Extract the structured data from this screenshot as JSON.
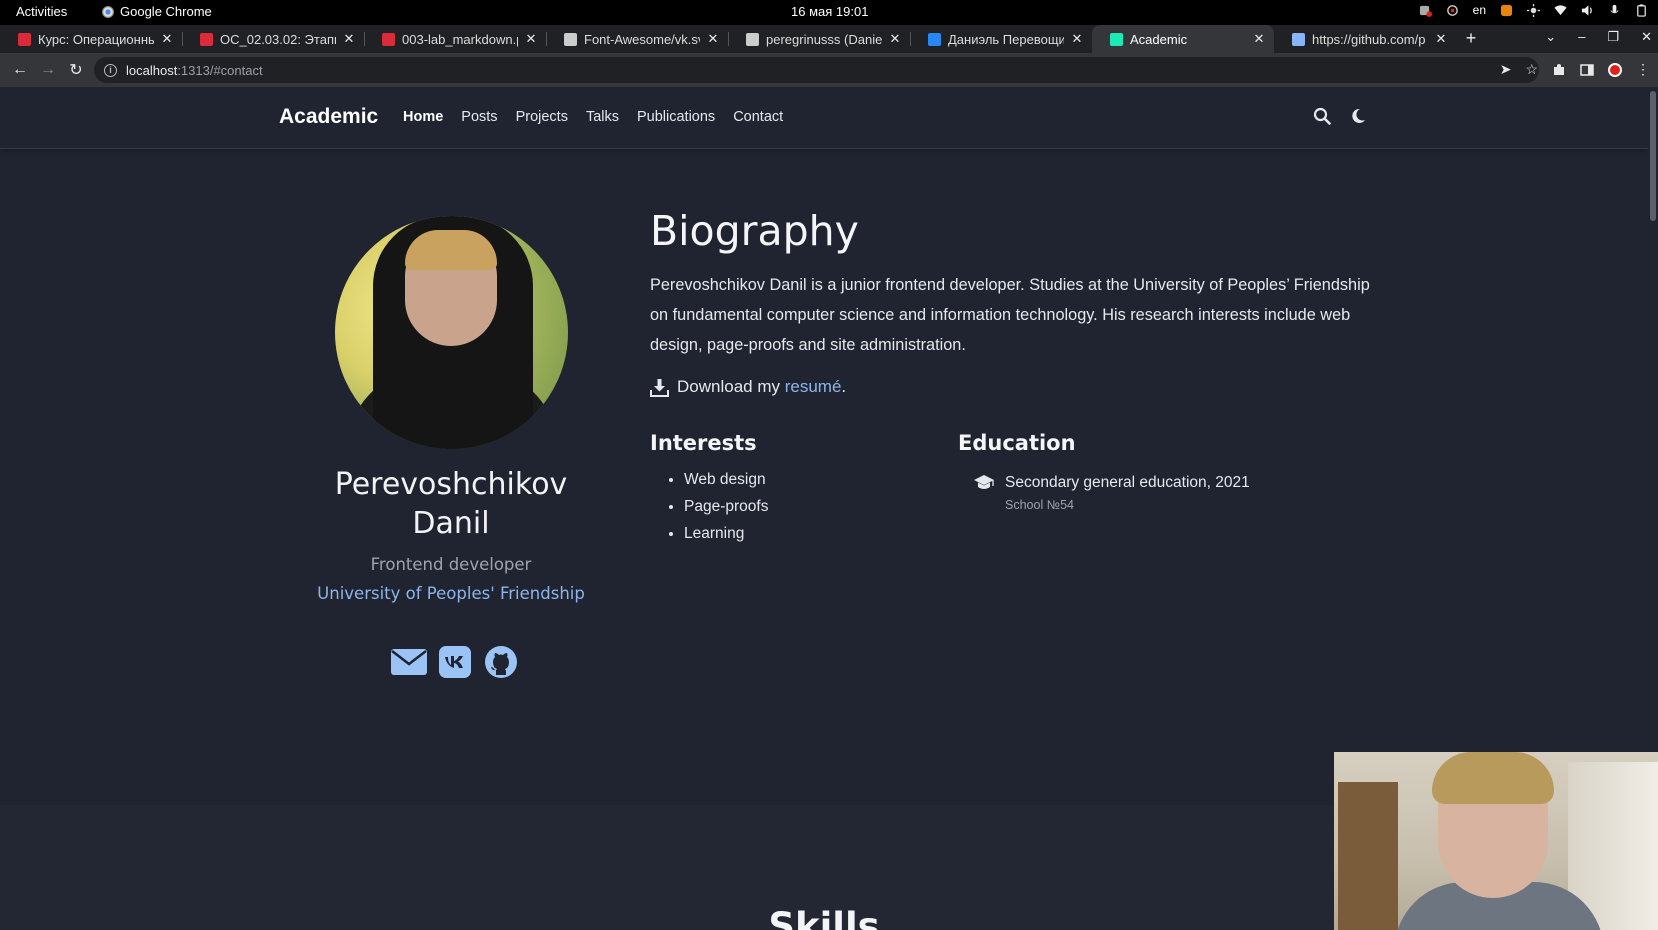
{
  "system_bar": {
    "activities": "Activities",
    "app_name": "Google Chrome",
    "clock": "16 мая  19:01",
    "lang": "en"
  },
  "browser": {
    "tabs": [
      {
        "title": "Курс: Операционные",
        "favicon_color": "#d92b3a"
      },
      {
        "title": "ОС_02.03.02: Этапы р",
        "favicon_color": "#d92b3a"
      },
      {
        "title": "003-lab_markdown.p",
        "favicon_color": "#d92b3a"
      },
      {
        "title": "Font-Awesome/vk.sv",
        "favicon_color": "#cccccc"
      },
      {
        "title": "peregrinusss (Daniel",
        "favicon_color": "#cccccc"
      },
      {
        "title": "Даниэль Перевощик",
        "favicon_color": "#2787f5"
      },
      {
        "title": "Academic",
        "favicon_color": "#1de9b6"
      },
      {
        "title": "https://github.com/p",
        "favicon_color": "#8ab4f8"
      }
    ],
    "active_tab_index": 6,
    "url_host": "localhost",
    "url_path": ":1313/#contact"
  },
  "site": {
    "brand": "Academic",
    "nav": [
      "Home",
      "Posts",
      "Projects",
      "Talks",
      "Publications",
      "Contact"
    ],
    "active_nav": "Home"
  },
  "profile": {
    "name": "Perevoshchikov Danil",
    "role": "Frontend developer",
    "organization": "University of Peoples' Friendship",
    "social": [
      "envelope-icon",
      "vk-icon",
      "github-icon"
    ]
  },
  "biography": {
    "title": "Biography",
    "text": "Perevoshchikov Danil is a junior frontend developer. Studies at the University of Peoples’ Friendship on fundamental computer science and information technology. His research interests include web design, page-proofs and site administration.",
    "download_prefix": "Download my ",
    "download_link": "resumé",
    "download_suffix": "."
  },
  "interests": {
    "title": "Interests",
    "items": [
      "Web design",
      "Page-proofs",
      "Learning"
    ]
  },
  "education": {
    "title": "Education",
    "degree": "Secondary general education, 2021",
    "school": "School №54"
  },
  "skills": {
    "title": "Skills"
  }
}
